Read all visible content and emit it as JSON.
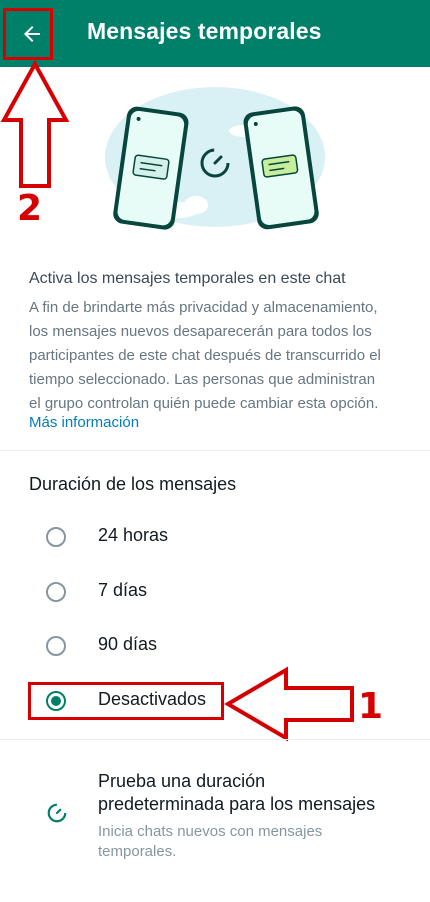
{
  "header": {
    "title": "Mensajes temporales",
    "back_icon": "arrow-left-icon"
  },
  "hero": {
    "illustration": "phones-timer-illustration"
  },
  "info": {
    "title": "Activa los mensajes temporales en este chat",
    "lines": [
      "A fin de brindarte más privacidad y almacenamiento,",
      "los mensajes nuevos desaparecerán para todos los",
      "participantes de este chat después de transcurrido el",
      "tiempo seleccionado. Las personas que administran",
      "el grupo controlan quién puede cambiar esta opción."
    ],
    "link": "Más información"
  },
  "duration": {
    "title": "Duración de los mensajes",
    "options": [
      {
        "label": "24 horas",
        "selected": false
      },
      {
        "label": "7 días",
        "selected": false
      },
      {
        "label": "90 días",
        "selected": false
      },
      {
        "label": "Desactivados",
        "selected": true
      }
    ]
  },
  "default_duration": {
    "title_line1": "Prueba una duración",
    "title_line2": "predeterminada para los mensajes",
    "sub_line1": "Inicia chats nuevos con mensajes",
    "sub_line2": "temporales.",
    "icon": "timer-icon"
  },
  "annotations": {
    "step_1": "1",
    "step_2": "2"
  },
  "colors": {
    "header_bg": "#008069",
    "accent": "#008069",
    "link": "#027eb5",
    "annotation": "#d60000"
  }
}
